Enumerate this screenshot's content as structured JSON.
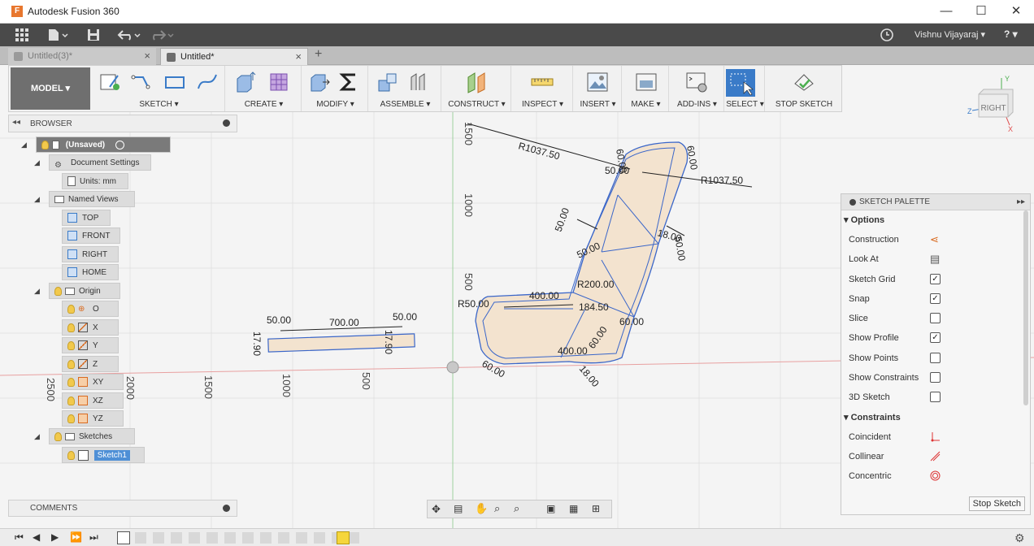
{
  "window": {
    "title": "Autodesk Fusion 360",
    "logo_letter": "F",
    "minimize": "—",
    "maximize": "☐",
    "close": "✕"
  },
  "quickbar": {
    "user": "Vishnu Vijayaraj ▾",
    "help": "? ▾",
    "apps_icon": "grid-icon",
    "file_icon": "file-icon",
    "save_icon": "save-icon",
    "undo_icon": "undo-icon",
    "redo_icon": "redo-icon"
  },
  "tabs": [
    {
      "label": "Untitled(3)*",
      "close": "×"
    },
    {
      "label": "Untitled*",
      "close": "×"
    }
  ],
  "new_tab": "+",
  "toolbar": {
    "model": "MODEL ▾",
    "groups": [
      {
        "label": "SKETCH ▾"
      },
      {
        "label": "CREATE ▾"
      },
      {
        "label": "MODIFY ▾"
      },
      {
        "label": "ASSEMBLE ▾"
      },
      {
        "label": "CONSTRUCT ▾"
      },
      {
        "label": "INSPECT ▾"
      },
      {
        "label": "INSERT ▾"
      },
      {
        "label": "MAKE ▾"
      },
      {
        "label": "ADD-INS ▾"
      },
      {
        "label": "SELECT ▾"
      },
      {
        "label": "STOP SKETCH"
      }
    ]
  },
  "viewcube": {
    "face": "RIGHT",
    "axis_y": "Y",
    "axis_z": "Z",
    "axis_x": "X"
  },
  "browser": {
    "header": "BROWSER",
    "items": [
      {
        "label": "(Unsaved)"
      },
      {
        "label": "Document Settings"
      },
      {
        "label": "Units: mm"
      },
      {
        "label": "Named Views"
      },
      {
        "label": "TOP"
      },
      {
        "label": "FRONT"
      },
      {
        "label": "RIGHT"
      },
      {
        "label": "HOME"
      },
      {
        "label": "Origin"
      },
      {
        "label": "O"
      },
      {
        "label": "X"
      },
      {
        "label": "Y"
      },
      {
        "label": "Z"
      },
      {
        "label": "XY"
      },
      {
        "label": "XZ"
      },
      {
        "label": "YZ"
      },
      {
        "label": "Sketches"
      },
      {
        "label": "Sketch1"
      }
    ]
  },
  "comments": {
    "label": "COMMENTS"
  },
  "palette": {
    "header": "SKETCH PALETTE",
    "options_title": "▾ Options",
    "options": [
      {
        "label": "Construction",
        "checked": null
      },
      {
        "label": "Look At",
        "checked": null
      },
      {
        "label": "Sketch Grid",
        "checked": true
      },
      {
        "label": "Snap",
        "checked": true
      },
      {
        "label": "Slice",
        "checked": false
      },
      {
        "label": "Show Profile",
        "checked": true
      },
      {
        "label": "Show Points",
        "checked": false
      },
      {
        "label": "Show Constraints",
        "checked": false
      },
      {
        "label": "3D Sketch",
        "checked": false
      }
    ],
    "constraints_title": "▾ Constraints",
    "constraints": [
      {
        "label": "Coincident"
      },
      {
        "label": "Collinear"
      },
      {
        "label": "Concentric"
      }
    ],
    "stop_button": "Stop Sketch",
    "check_mark": "✓"
  },
  "sketch": {
    "axis_labels": [
      {
        "text": "1500"
      },
      {
        "text": "1000"
      },
      {
        "text": "500"
      },
      {
        "text": "500"
      },
      {
        "text": "1000"
      },
      {
        "text": "1500"
      },
      {
        "text": "2000"
      },
      {
        "text": "2500"
      }
    ],
    "dimensions": [
      {
        "text": "R1037.50"
      },
      {
        "text": "R1037.50"
      },
      {
        "text": "50.00"
      },
      {
        "text": "60.00"
      },
      {
        "text": "60.00"
      },
      {
        "text": "50.00"
      },
      {
        "text": "18.00"
      },
      {
        "text": "50.00"
      },
      {
        "text": "50.00"
      },
      {
        "text": "R200.00"
      },
      {
        "text": "400.00"
      },
      {
        "text": "R50.00"
      },
      {
        "text": "184.50"
      },
      {
        "text": "400.00"
      },
      {
        "text": "60.00"
      },
      {
        "text": "18.00"
      },
      {
        "text": "50.00"
      },
      {
        "text": "700.00"
      },
      {
        "text": "50.00"
      },
      {
        "text": "17.90"
      },
      {
        "text": "17.90"
      },
      {
        "text": "60.00"
      },
      {
        "text": "60.00"
      }
    ]
  }
}
